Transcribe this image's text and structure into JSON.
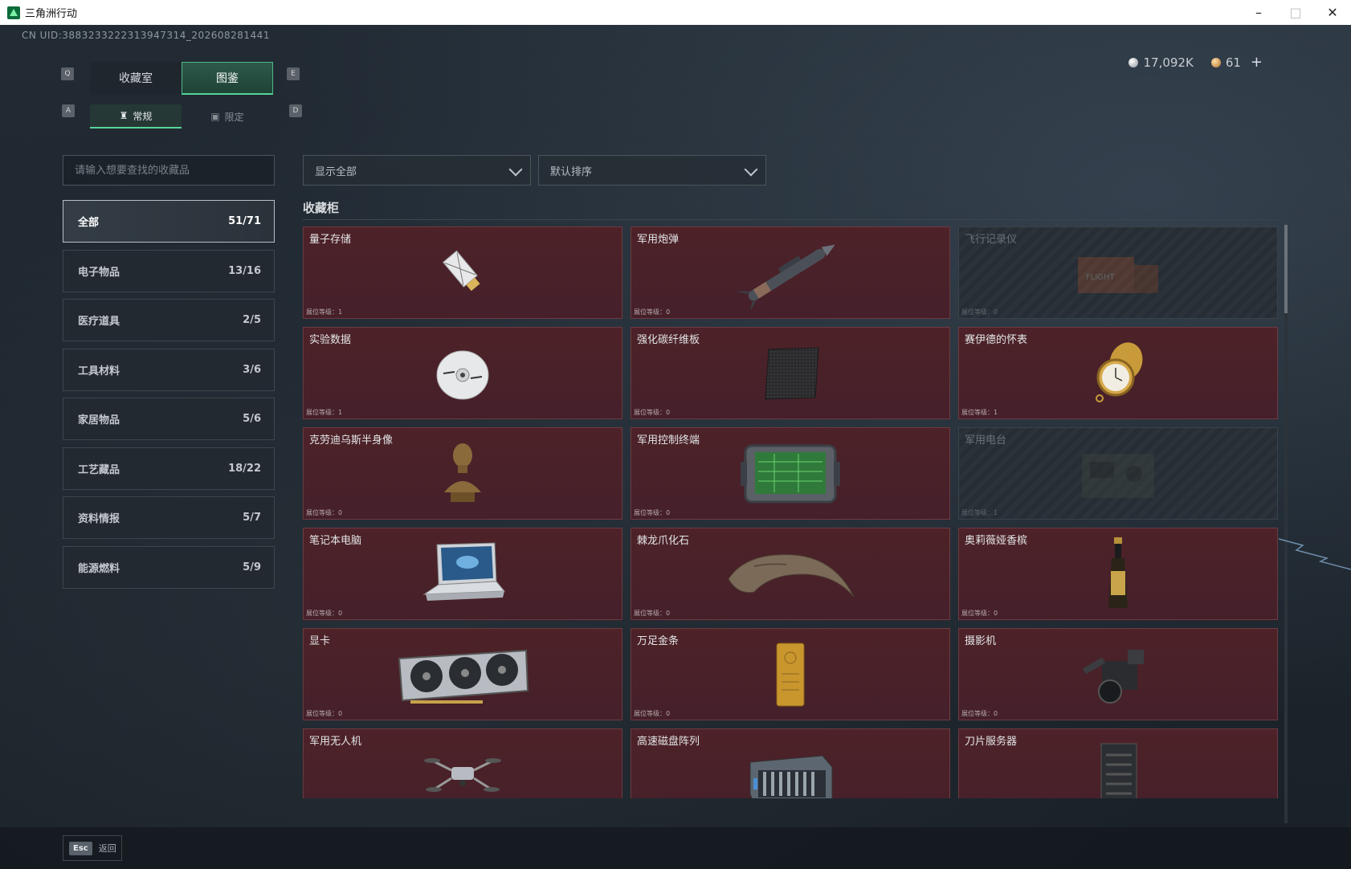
{
  "window": {
    "title": "三角洲行动",
    "minimize": "–",
    "maximize": "□",
    "close": "✕"
  },
  "uid": "CN UID:3883233222313947314_202608281441",
  "currency": {
    "silver": "17,092K",
    "gold": "61",
    "plus": "+"
  },
  "keys": {
    "q": "Q",
    "e": "E",
    "a": "A",
    "d": "D"
  },
  "tabs": [
    {
      "label": "收藏室"
    },
    {
      "label": "图鉴"
    }
  ],
  "subtabs": [
    {
      "label": "常规"
    },
    {
      "label": "限定"
    }
  ],
  "search": {
    "placeholder": "请输入想要查找的收藏品"
  },
  "filters": {
    "display": "显示全部",
    "sort": "默认排序"
  },
  "categories": [
    {
      "label": "全部",
      "count": "51/71"
    },
    {
      "label": "电子物品",
      "count": "13/16"
    },
    {
      "label": "医疗道具",
      "count": "2/5"
    },
    {
      "label": "工具材料",
      "count": "3/6"
    },
    {
      "label": "家居物品",
      "count": "5/6"
    },
    {
      "label": "工艺藏品",
      "count": "18/22"
    },
    {
      "label": "资料情报",
      "count": "5/7"
    },
    {
      "label": "能源燃料",
      "count": "5/9"
    }
  ],
  "section_title": "收藏柜",
  "items": [
    {
      "name": "量子存储",
      "level": "展位等级：1",
      "icon": "usb-drive-icon",
      "locked": false
    },
    {
      "name": "军用炮弹",
      "level": "展位等级：0",
      "icon": "missile-icon",
      "locked": false
    },
    {
      "name": "飞行记录仪",
      "level": "展位等级：0",
      "icon": "flight-recorder-icon",
      "locked": true
    },
    {
      "name": "实验数据",
      "level": "展位等级：1",
      "icon": "disc-icon",
      "locked": false
    },
    {
      "name": "强化碳纤维板",
      "level": "展位等级：0",
      "icon": "carbon-plate-icon",
      "locked": false
    },
    {
      "name": "赛伊德的怀表",
      "level": "展位等级：1",
      "icon": "pocket-watch-icon",
      "locked": false
    },
    {
      "name": "克劳迪乌斯半身像",
      "level": "展位等级：0",
      "icon": "bust-icon",
      "locked": false
    },
    {
      "name": "军用控制终端",
      "level": "展位等级：0",
      "icon": "control-terminal-icon",
      "locked": false
    },
    {
      "name": "军用电台",
      "level": "展位等级：1",
      "icon": "radio-icon",
      "locked": true
    },
    {
      "name": "笔记本电脑",
      "level": "展位等级：0",
      "icon": "laptop-icon",
      "locked": false
    },
    {
      "name": "棘龙爪化石",
      "level": "展位等级：0",
      "icon": "claw-fossil-icon",
      "locked": false
    },
    {
      "name": "奥莉薇娅香槟",
      "level": "展位等级：0",
      "icon": "champagne-icon",
      "locked": false
    },
    {
      "name": "显卡",
      "level": "展位等级：0",
      "icon": "graphics-card-icon",
      "locked": false
    },
    {
      "name": "万足金条",
      "level": "展位等级：0",
      "icon": "gold-bar-icon",
      "locked": false
    },
    {
      "name": "摄影机",
      "level": "展位等级：0",
      "icon": "camera-icon",
      "locked": false
    },
    {
      "name": "军用无人机",
      "level": "",
      "icon": "drone-icon",
      "locked": false
    },
    {
      "name": "高速磁盘阵列",
      "level": "",
      "icon": "disk-array-icon",
      "locked": false
    },
    {
      "name": "刀片服务器",
      "level": "",
      "icon": "blade-server-icon",
      "locked": false
    }
  ],
  "bottom": {
    "esc_key": "Esc",
    "esc_label": "返回"
  },
  "colors": {
    "accent": "#56d49a",
    "item_bg": "#4d2228",
    "locked_bg": "#262d34"
  }
}
